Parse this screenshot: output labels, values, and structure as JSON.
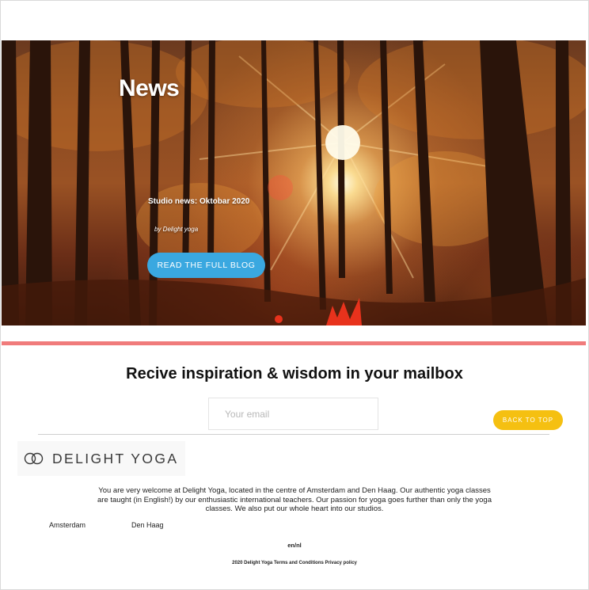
{
  "hero": {
    "title": "News",
    "post_title": "Studio news: Oktobar 2020",
    "post_author": "by Delight yoga",
    "read_button": "READ THE FULL BLOG"
  },
  "newsletter": {
    "title": "Recive inspiration & wisdom in your mailbox",
    "email_placeholder": "Your email"
  },
  "back_to_top": "BACK TO TOP",
  "footer": {
    "logo_text": "DELIGHT YOGA",
    "about": "You are very welcome at Delight Yoga, located in the centre of Amsterdam and Den Haag. Our authentic yoga classes are taught (in English!) by our enthusiastic international teachers. Our passion for yoga goes further than only the yoga classes. We also put our whole heart into our studios.",
    "locations": [
      "Amsterdam",
      "Den Haag"
    ],
    "language_switch": "en/nl",
    "copyright": "2020 Delight Yoga",
    "terms_link": "Terms and Conditions",
    "privacy_link": "Privacy policy"
  },
  "colors": {
    "accent_blue": "#3aa8e0",
    "divider_red": "#f07b7b",
    "back_to_top_yellow": "#f5c011"
  }
}
